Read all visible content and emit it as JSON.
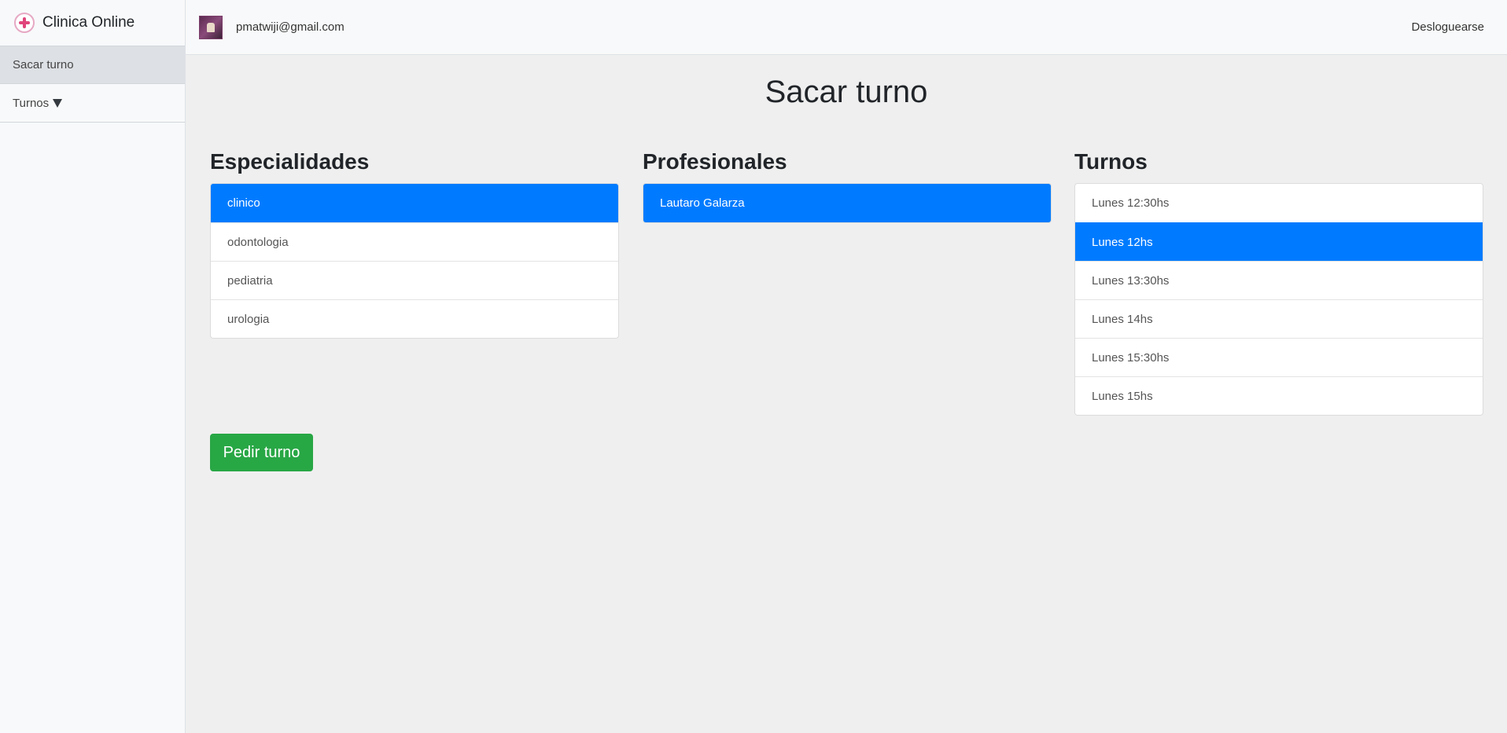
{
  "app": {
    "brand": "Clinica Online"
  },
  "sidebar": {
    "items": [
      {
        "label": "Sacar turno",
        "active": true
      },
      {
        "label": "Turnos",
        "active": false,
        "icon": "caret-down-icon"
      }
    ]
  },
  "topbar": {
    "email": "pmatwiji@gmail.com",
    "logout_label": "Desloguearse"
  },
  "main": {
    "title": "Sacar turno",
    "especialidades": {
      "title": "Especialidades",
      "items": [
        "clinico",
        "odontologia",
        "pediatria",
        "urologia"
      ],
      "selected": "clinico"
    },
    "profesionales": {
      "title": "Profesionales",
      "items": [
        "Lautaro Galarza"
      ],
      "selected": "Lautaro Galarza"
    },
    "turnos": {
      "title": "Turnos",
      "items": [
        "Lunes 12:30hs",
        "Lunes 12hs",
        "Lunes 13:30hs",
        "Lunes 14hs",
        "Lunes 15:30hs",
        "Lunes 15hs"
      ],
      "selected": "Lunes 12hs"
    },
    "submit_label": "Pedir turno"
  },
  "colors": {
    "active": "#007bff",
    "submit": "#28a745"
  }
}
